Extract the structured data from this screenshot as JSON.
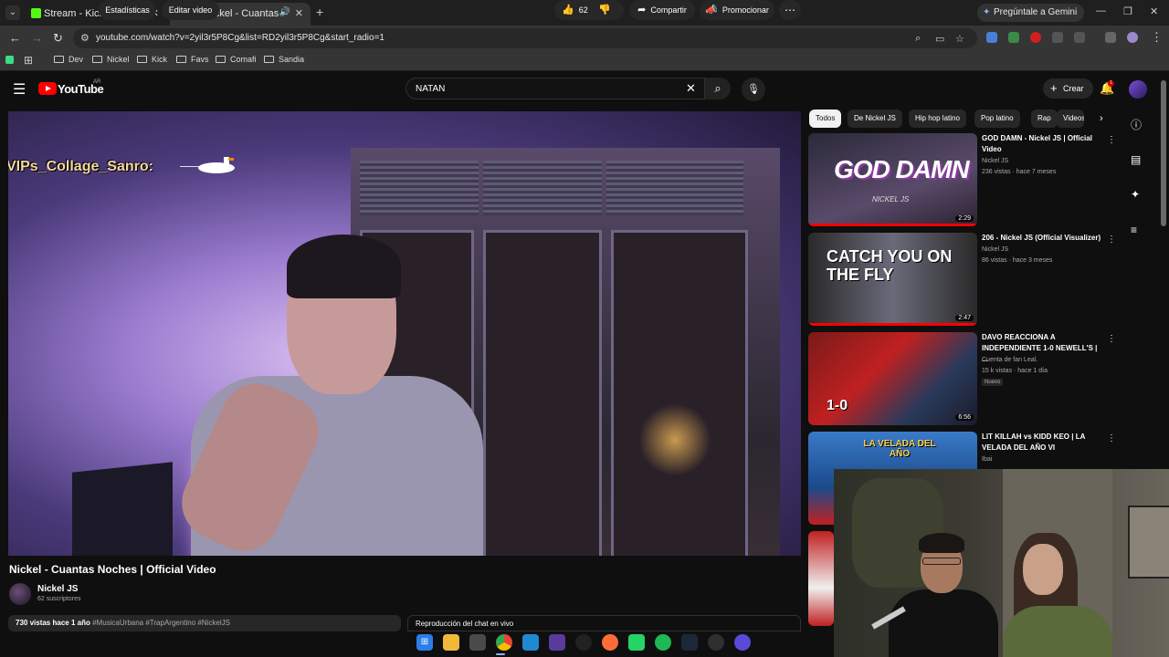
{
  "browser": {
    "tabs": [
      {
        "title": "Stream - Kick Dashboard",
        "favicon_color": "#53fc18"
      },
      {
        "title": "(1) Nickel - Cuantas Noches",
        "favicon_color": "#ff0000"
      }
    ],
    "gemini_label": "Pregúntale a Gemini",
    "url": "youtube.com/watch?v=2yil3r5P8Cg&list=RD2yil3r5P8Cg&start_radio=1",
    "bookmarks": [
      "Dev",
      "Nickel",
      "Kick",
      "Favs",
      "Comafi",
      "Sandia"
    ]
  },
  "youtube": {
    "logo_text": "YouTube",
    "country": "AR",
    "search_query": "NATAN",
    "create_label": "Crear",
    "notification_count": "1"
  },
  "video": {
    "overlay_text": "VIPs_Collage_Sanro:",
    "title": "Nickel - Cuantas Noches | Official Video",
    "channel": "Nickel JS",
    "subscribers": "62 suscriptores",
    "stats_button": "Estadísticas",
    "edit_button": "Editar video",
    "likes": "62",
    "share_label": "Compartir",
    "promote_label": "Promocionar",
    "views": "730 vistas",
    "age": "hace 1 año",
    "hashtags": "#MusicaUrbana #TrapArgentino #NickelJS",
    "chat_replay": "Reproducción del chat en vivo"
  },
  "chips": [
    "Todos",
    "De Nickel JS",
    "Hip hop latino",
    "Pop latino",
    "Rap",
    "Videos"
  ],
  "recommendations": [
    {
      "title": "GOD DAMN - Nickel JS | Official Video",
      "channel": "Nickel JS",
      "meta": "236 vistas · hace 7 meses",
      "duration": "2:29",
      "thumb_text": "GOD DAMN",
      "thumb_sub": "NICKEL JS",
      "progress": 1.0
    },
    {
      "title": "206 - Nickel JS (Official Visualizer)",
      "channel": "Nickel JS",
      "meta": "86 vistas · hace 3 meses",
      "duration": "2:47",
      "thumb_text": "CATCH YOU ON THE FLY",
      "progress": 1.0
    },
    {
      "title": "DAVO REACCIONA A INDEPENDIENTE 1-0 NEWELL'S | ...",
      "channel": "Cuenta de fan Leal.",
      "meta": "15 k vistas · hace 1 día",
      "badge": "Nuevo",
      "duration": "6:56",
      "thumb_text": "1-0"
    },
    {
      "title": "LIT KILLAH vs KIDD KEO | LA VELADA DEL AÑO VI",
      "channel": "Ibai",
      "thumb_text": "LA VELADA DEL AÑO"
    }
  ],
  "taskbar_apps": [
    "start",
    "explorer",
    "store",
    "chrome",
    "vscode",
    "vs",
    "github",
    "postman",
    "whatsapp",
    "spotify",
    "steam",
    "obs",
    "app"
  ],
  "colors": {
    "accent_red": "#ff0000",
    "bg": "#0f0f0f",
    "chip_bg": "#272727",
    "kick_green": "#53fc18"
  }
}
